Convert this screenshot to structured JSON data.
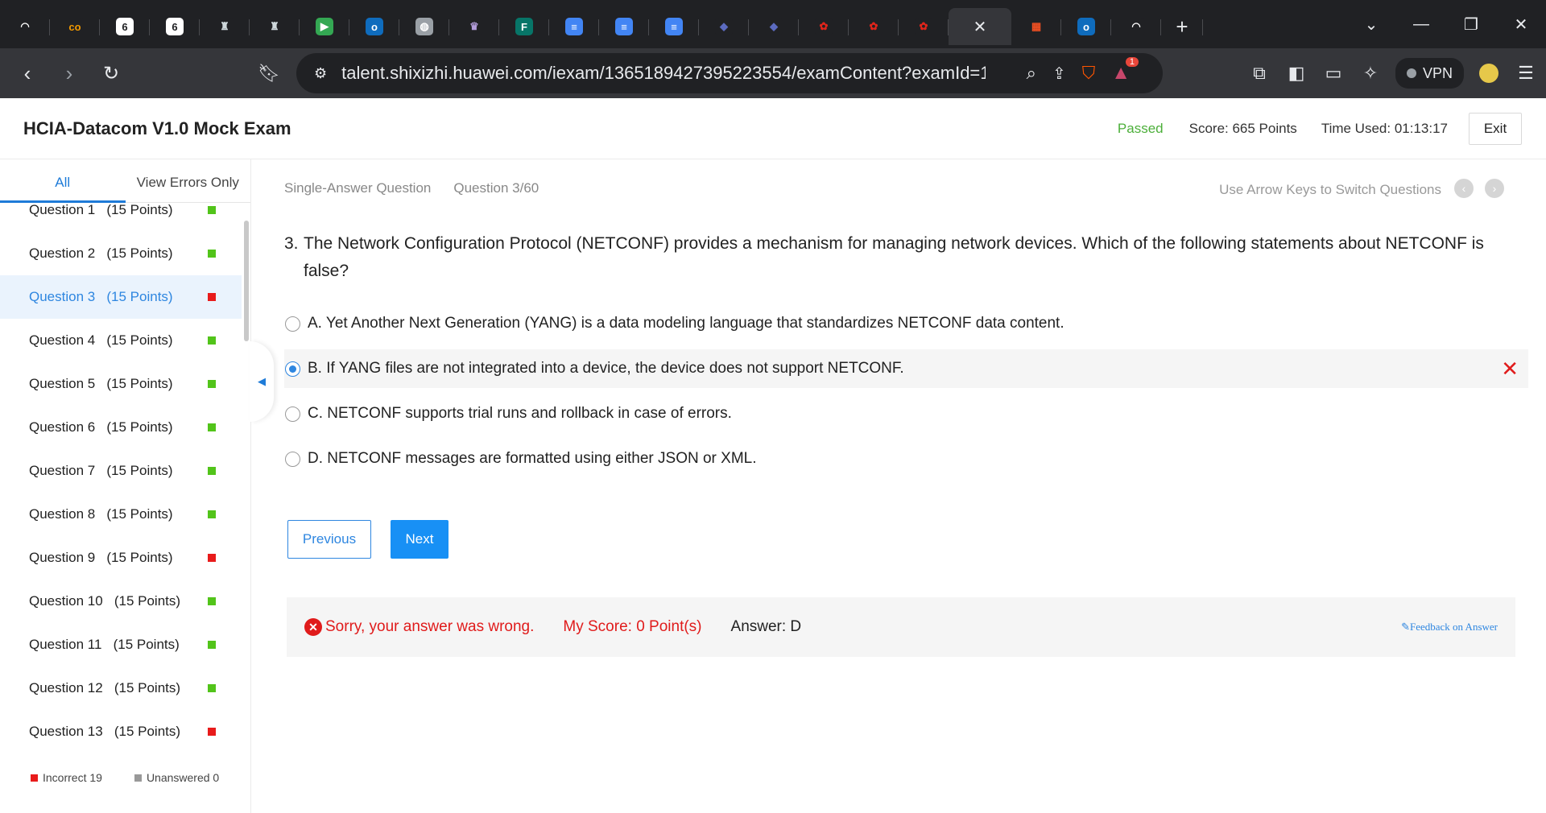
{
  "browser": {
    "tabs": [
      {
        "icon": "speedometer-icon",
        "glyph": "◠",
        "color": "#202124"
      },
      {
        "icon": "co-logo-icon",
        "glyph": "co",
        "color": "#202124",
        "fg": "#f29900"
      },
      {
        "icon": "six-logo-icon",
        "glyph": "6",
        "color": "#ffffff",
        "fg": "#202124"
      },
      {
        "icon": "six-logo-icon",
        "glyph": "6",
        "color": "#ffffff",
        "fg": "#202124"
      },
      {
        "icon": "emblem-icon",
        "glyph": "♜",
        "color": "#202124",
        "fg": "#cfd8dc"
      },
      {
        "icon": "emblem-icon",
        "glyph": "♜",
        "color": "#202124",
        "fg": "#cfd8dc"
      },
      {
        "icon": "meet-icon",
        "glyph": "▶",
        "color": "#34a853"
      },
      {
        "icon": "outlook-icon",
        "glyph": "o",
        "color": "#0f6cbd"
      },
      {
        "icon": "globe-icon",
        "glyph": "◍",
        "color": "#9aa0a6"
      },
      {
        "icon": "university-icon",
        "glyph": "♛",
        "color": "#202124",
        "fg": "#b39ddb"
      },
      {
        "icon": "forms-icon",
        "glyph": "F",
        "color": "#077568"
      },
      {
        "icon": "docs-icon",
        "glyph": "≡",
        "color": "#4285f4"
      },
      {
        "icon": "docs-icon",
        "glyph": "≡",
        "color": "#4285f4"
      },
      {
        "icon": "docs-icon",
        "glyph": "≡",
        "color": "#4285f4"
      },
      {
        "icon": "bird-icon",
        "glyph": "◆",
        "color": "#202124",
        "fg": "#5c6bc0"
      },
      {
        "icon": "bird-icon",
        "glyph": "◆",
        "color": "#202124",
        "fg": "#5c6bc0"
      },
      {
        "icon": "huawei-icon",
        "glyph": "✿",
        "color": "#202124",
        "fg": "#e1251b"
      },
      {
        "icon": "huawei-icon",
        "glyph": "✿",
        "color": "#202124",
        "fg": "#e1251b"
      },
      {
        "icon": "huawei-icon",
        "glyph": "✿",
        "color": "#202124",
        "fg": "#e1251b"
      }
    ],
    "active_tab_close": "✕",
    "after_tabs": [
      {
        "icon": "microsoft-icon",
        "glyph": "▦",
        "color": "#202124",
        "fg": "#f25022"
      },
      {
        "icon": "outlook-icon",
        "glyph": "o",
        "color": "#0f6cbd"
      },
      {
        "icon": "speedometer-icon",
        "glyph": "◠",
        "color": "#202124"
      }
    ],
    "new_tab": "+",
    "url": "talent.shixizhi.huawei.com/iexam/1365189427395223554/examContent?examId=1...",
    "vpn_label": "VPN",
    "brave_badge": "1"
  },
  "header": {
    "title": "HCIA-Datacom V1.0 Mock Exam",
    "status": "Passed",
    "score": "Score: 665 Points",
    "time": "Time Used: 01:13:17",
    "exit": "Exit"
  },
  "sidebar": {
    "tabs": [
      "All",
      "View Errors Only"
    ],
    "questions": [
      {
        "label": "Question 1   (15 Points)",
        "status": "correct"
      },
      {
        "label": "Question 2   (15 Points)",
        "status": "correct"
      },
      {
        "label": "Question 3   (15 Points)",
        "status": "incorrect",
        "current": true
      },
      {
        "label": "Question 4   (15 Points)",
        "status": "correct"
      },
      {
        "label": "Question 5   (15 Points)",
        "status": "correct"
      },
      {
        "label": "Question 6   (15 Points)",
        "status": "correct"
      },
      {
        "label": "Question 7   (15 Points)",
        "status": "correct"
      },
      {
        "label": "Question 8   (15 Points)",
        "status": "correct"
      },
      {
        "label": "Question 9   (15 Points)",
        "status": "incorrect"
      },
      {
        "label": "Question 10   (15 Points)",
        "status": "correct"
      },
      {
        "label": "Question 11   (15 Points)",
        "status": "correct"
      },
      {
        "label": "Question 12   (15 Points)",
        "status": "correct"
      },
      {
        "label": "Question 13   (15 Points)",
        "status": "incorrect"
      }
    ],
    "legend": {
      "incorrect": "Incorrect 19",
      "unanswered": "Unanswered 0"
    },
    "colors": {
      "correct": "#52c41a",
      "incorrect": "#e81b1b",
      "unanswered": "#999999"
    }
  },
  "main": {
    "type": "Single-Answer Question",
    "progress": "Question 3/60",
    "hint": "Use Arrow Keys to Switch Questions",
    "question_number": "3.",
    "question_text": "The Network Configuration Protocol (NETCONF) provides a mechanism for managing network devices. Which of the following statements about NETCONF is false?",
    "options": [
      {
        "text": "A. Yet Another Next Generation (YANG) is a data modeling language that standardizes NETCONF data content.",
        "selected": false
      },
      {
        "text": "B. If YANG files are not integrated into a device, the device does not support NETCONF.",
        "selected": true,
        "wrong": true
      },
      {
        "text": "C. NETCONF supports trial runs and rollback in case of errors.",
        "selected": false
      },
      {
        "text": "D. NETCONF messages are formatted using either JSON or XML.",
        "selected": false
      }
    ],
    "prev_label": "Previous",
    "next_label": "Next",
    "result": {
      "message": "Sorry, your answer was wrong.",
      "my_score": "My Score: 0 Point(s)",
      "answer": "Answer: D",
      "feedback": "Feedback on Answer"
    }
  }
}
